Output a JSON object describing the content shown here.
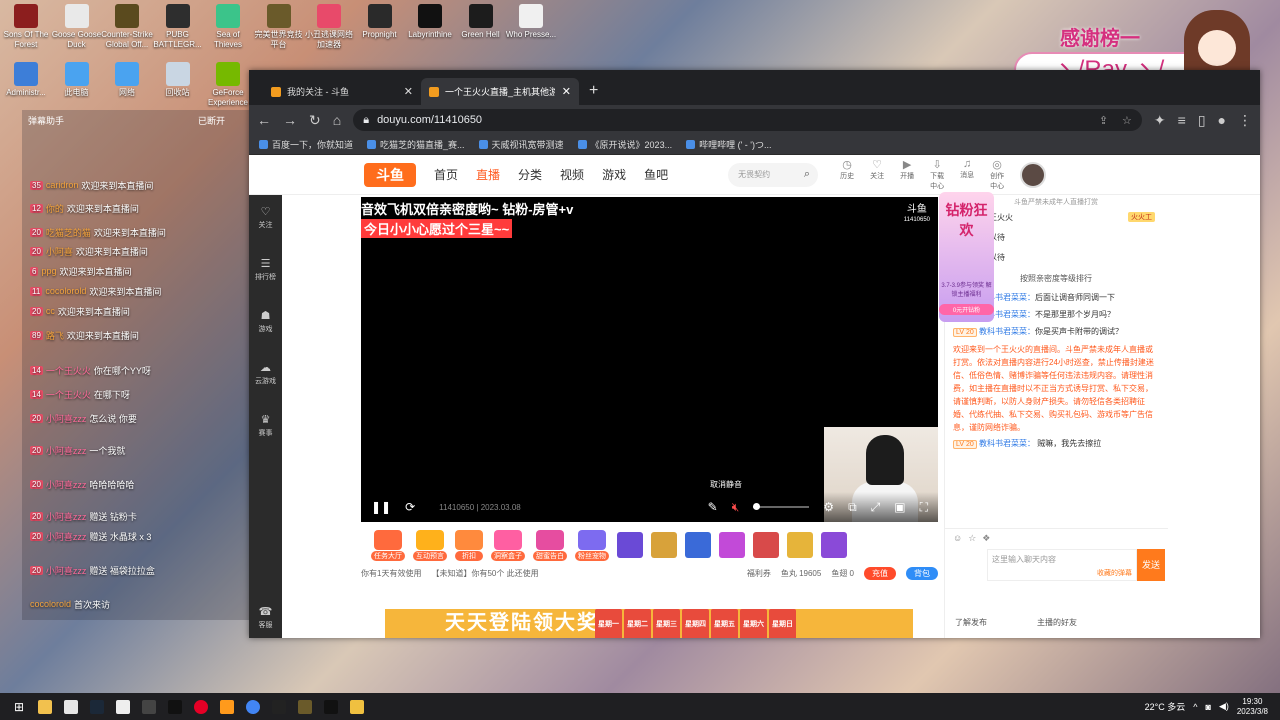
{
  "desktop": {
    "icons_row1": [
      {
        "label": "Sons Of The Forest",
        "color": "#8c1e1e"
      },
      {
        "label": "Goose Goose Duck",
        "color": "#e9e9e9"
      },
      {
        "label": "Counter-Strike Global Off...",
        "color": "#5a4a1e"
      },
      {
        "label": "PUBG BATTLEGR...",
        "color": "#2e2e2e"
      },
      {
        "label": "Sea of Thieves",
        "color": "#3bc48a"
      },
      {
        "label": "完美世界竞技平台",
        "color": "#6a5a2a"
      },
      {
        "label": "小丑逃课网络加速器",
        "color": "#e84a6a"
      },
      {
        "label": "Propnight",
        "color": "#2a2a2a"
      },
      {
        "label": "Labyrinthine",
        "color": "#111111"
      },
      {
        "label": "Green Hell",
        "color": "#1c1c1c"
      },
      {
        "label": "Who Presse...",
        "color": "#f0f0f0"
      }
    ],
    "icons_row2": [
      {
        "label": "Administr...",
        "color": "#3d7ed8"
      },
      {
        "label": "此电脑",
        "color": "#4aa3f0"
      },
      {
        "label": "网络",
        "color": "#4aa3f0"
      },
      {
        "label": "回收站",
        "color": "#c9d6e3"
      },
      {
        "label": "GeForce Experience",
        "color": "#76b900"
      }
    ]
  },
  "chat_overlay": {
    "header": "弹幕助手",
    "header_right": "已断开",
    "lines": [
      {
        "lvl": "35",
        "user": "caridron",
        "text": "欢迎来到本直播间"
      },
      {
        "lvl": "12",
        "user": "你的",
        "text": "欢迎来到本直播间"
      },
      {
        "lvl": "20",
        "user": "吃猫芝的猫",
        "text": "欢迎来到本直播间"
      },
      {
        "lvl": "20",
        "user": "小阿喜",
        "text": "欢迎来到本直播间"
      },
      {
        "lvl": "6",
        "user": "ppg",
        "text": "欢迎来到本直播间"
      },
      {
        "lvl": "11",
        "user": "cocolorold",
        "text": "欢迎来到本直播间"
      },
      {
        "lvl": "20",
        "user": "cc",
        "text": "欢迎来到本直播间"
      },
      {
        "lvl": "89",
        "user": "路飞",
        "text": "欢迎来到本直播间"
      },
      {
        "lvl": "14",
        "user": "一个王火火",
        "text": "你在哪个YY呀"
      },
      {
        "lvl": "14",
        "user": "一个王火火",
        "text": "在哪下呀"
      },
      {
        "lvl": "20",
        "user": "小阿喜zzz",
        "text": "怎么说 你要"
      },
      {
        "lvl": "20",
        "user": "小阿喜zzz",
        "text": "一个我就"
      },
      {
        "lvl": "20",
        "user": "小阿喜zzz",
        "text": "哈哈哈哈哈"
      },
      {
        "lvl": "20",
        "user": "小阿喜zzz",
        "text": "赠送 钻粉卡"
      },
      {
        "lvl": "20",
        "user": "小阿喜zzz",
        "text": "赠送 水晶球 x 3"
      },
      {
        "lvl": "20",
        "user": "小阿喜zzz",
        "text": "赠送 福袋拉拉盒"
      }
    ],
    "footer_user": "cocolorold",
    "footer_text": "首次来访"
  },
  "browser": {
    "tabs": [
      {
        "title": "我的关注 - 斗鱼",
        "active": false
      },
      {
        "title": "一个王火火直播_主机其他游戏直播",
        "active": true
      }
    ],
    "url": "douyu.com/11410650",
    "bookmarks": [
      "百度一下，你就知道",
      "吃猫芝的猫直播_赛...",
      "天威视讯宽带测速",
      "《原开说说》2023...",
      "哔哩哔哩 (' - ')つ..."
    ]
  },
  "site": {
    "logo": "斗鱼",
    "nav": [
      "首页",
      "直播",
      "分类",
      "视频",
      "游戏",
      "鱼吧"
    ],
    "search_placeholder": "无畏契约",
    "header_icons": [
      "历史",
      "关注",
      "开播",
      "下载中心",
      "消息",
      "创作中心"
    ],
    "rail": [
      "关注",
      "排行榜",
      "游戏",
      "云游戏",
      "赛事",
      "客服"
    ],
    "video": {
      "title": "音效飞机双倍亲密度哟~ 钻粉-房管+v",
      "subtitle": "今日小小心愿过个三星~~",
      "logo": "斗鱼",
      "room_id": "11410650",
      "room_info": "11410650 | 2023.03.08",
      "tooltip": "取消静音",
      "volume": 0
    },
    "gifts": [
      "任务大厅",
      "互动预言",
      "折扣",
      "洞察盒子",
      "甜蜜告白",
      "粉丝宠物"
    ],
    "bottom": {
      "tip1": "你有1天有效使用",
      "tip2": "【未知道】你有50个 此还使用",
      "fish_balls": "鱼丸 19605",
      "fish_wings": "鱼翅 0",
      "card": "福利券",
      "recharge": "充值",
      "bag": "背包"
    },
    "banner": {
      "text": "天天登陆领大奖",
      "days": [
        "星期一",
        "星期二",
        "星期三",
        "星期四",
        "星期五",
        "星期六",
        "星期日"
      ]
    },
    "side": {
      "notice": "斗鱼严禁未成年人直播打赏",
      "ranks": [
        {
          "num": "1",
          "name": "两个王火火",
          "badge": "火火工"
        },
        {
          "num": "2",
          "name": "虚位以待",
          "badge": ""
        },
        {
          "num": "3",
          "name": "虚位以待",
          "badge": ""
        }
      ],
      "rank_more": "按照亲密度等级排行",
      "messages": [
        {
          "lv": "LV 20",
          "name": "教科书君菜菜：",
          "text": "后面让调音师同调一下"
        },
        {
          "lv": "LV 20",
          "name": "教科书君菜菜：",
          "text": "不是那里那个岁月吗？"
        },
        {
          "lv": "LV 20",
          "name": "教科书君菜菜：",
          "text": "你是买声卡附带的调试？"
        }
      ],
      "system": "欢迎来到一个王火火的直播间。斗鱼严禁未成年人直播或打赏。依法对直播内容进行24小时巡查，禁止传播封建迷信、低俗色情、赌博诈骗等任何违法违规内容。请理性消费，如主播在直播时以不正当方式诱导打赏、私下交易，请谨慎判断，以防人身财产损失。请勿轻信各类招聘征婚、代练代抽、私下交易、购买礼包码、游戏币等广告信息，谨防网络诈骗。",
      "last": {
        "lv": "LV 20",
        "name": "教科书君菜菜：",
        "text": "贼嘛，我先去擦拉"
      },
      "input_placeholder": "这里输入聊天内容",
      "emoji_hint": "收藏的弹幕",
      "send": "发送",
      "friends_label": "了解发布",
      "friends_right": "主播的好友"
    },
    "promo": {
      "title": "钻粉狂欢",
      "sub": "3.7-3.9参与领奖 解锁主播福利",
      "btn": "0元开钻粉"
    }
  },
  "thanks_overlay": {
    "title": "感谢榜一",
    "name": "ヽ/Ray ヽ/"
  },
  "taskbar": {
    "weather": "22°C 多云",
    "time": "19:30",
    "date": "2023/3/8"
  }
}
